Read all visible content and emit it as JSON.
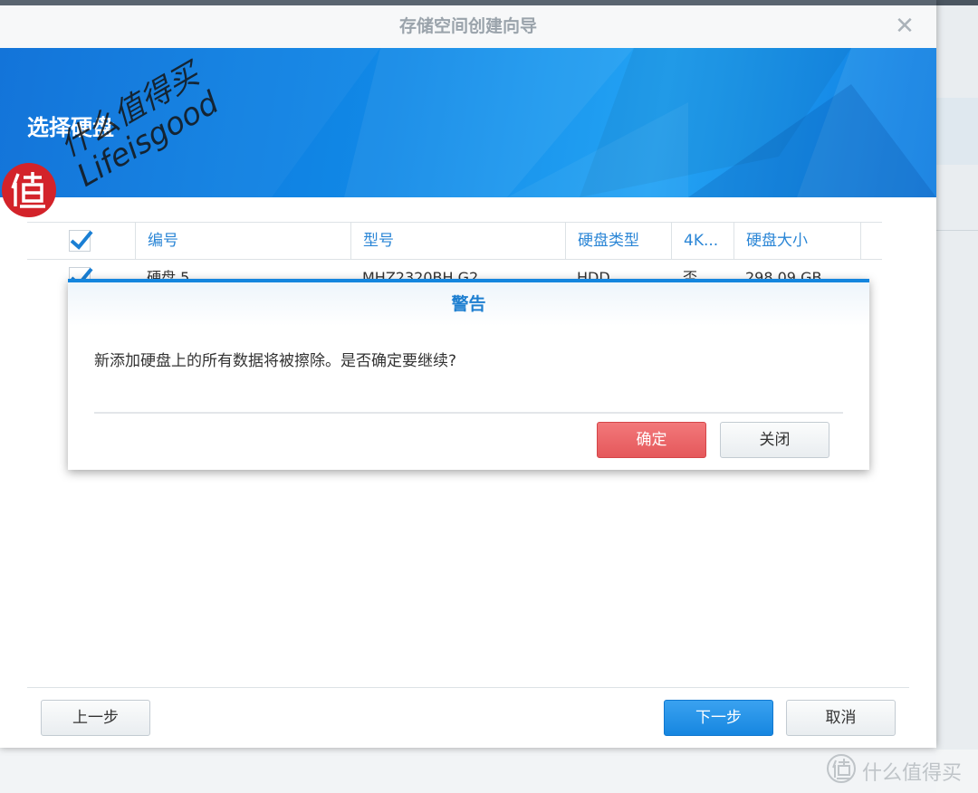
{
  "window": {
    "title": "存储空间创建向导",
    "banner_title": "选择硬盘"
  },
  "table": {
    "columns": [
      "编号",
      "型号",
      "硬盘类型",
      "4K...",
      "硬盘大小"
    ],
    "rows": [
      {
        "checked": true,
        "id": "硬盘 5",
        "model": "MHZ2320BH G2",
        "type": "HDD",
        "fourk": "否",
        "size": "298.09 GB"
      }
    ],
    "header_checked": true
  },
  "footer": {
    "prev_label": "上一步",
    "next_label": "下一步",
    "cancel_label": "取消"
  },
  "dialog": {
    "title": "警告",
    "message": "新添加硬盘上的所有数据将被擦除。是否确定要继续?",
    "confirm_label": "确定",
    "close_label": "关闭"
  },
  "watermark": {
    "line1": "什么值得买",
    "line2": "Lifeisgood",
    "corner": "什么值得买"
  },
  "colors": {
    "accent": "#1485de",
    "banner": "#1188e6",
    "confirm": "#e5585b"
  }
}
